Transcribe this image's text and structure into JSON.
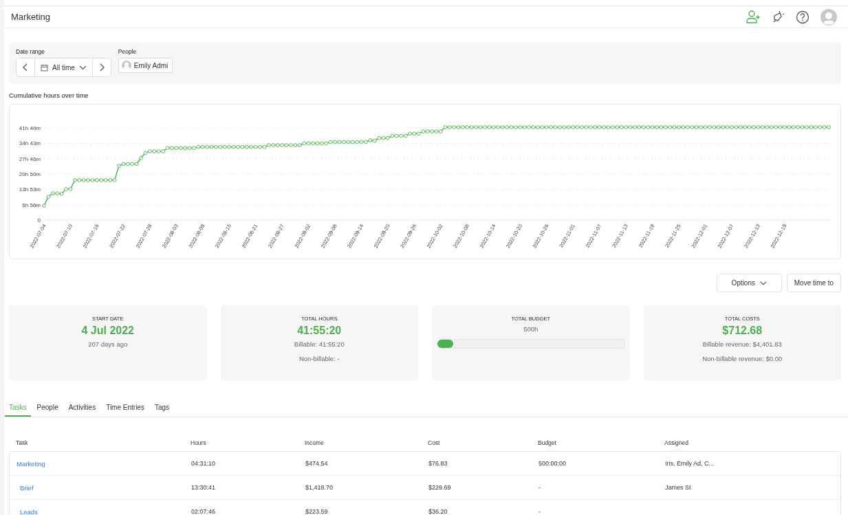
{
  "header": {
    "title": "Marketing"
  },
  "filters": {
    "date_range": {
      "label": "Date range",
      "value": "All time"
    },
    "people": {
      "label": "People",
      "value": "Emily Admi"
    }
  },
  "chart": {
    "title": "Cumulative hours over time",
    "y_labels": [
      "41h 40m",
      "34h 43m",
      "27h 46m",
      "20h 50m",
      "13h 53m",
      "6h 56m",
      "0"
    ],
    "x_labels": [
      "2022-07-04",
      "2022-07-10",
      "2022-07-16",
      "2022-07-22",
      "2022-07-28",
      "2022-08-03",
      "2022-08-09",
      "2022-08-15",
      "2022-08-21",
      "2022-08-27",
      "2022-09-02",
      "2022-09-08",
      "2022-09-14",
      "2022-09-20",
      "2022-09-26",
      "2022-10-02",
      "2022-10-08",
      "2022-10-14",
      "2022-10-20",
      "2022-10-26",
      "2022-11-01",
      "2022-11-07",
      "2022-11-13",
      "2022-11-19",
      "2022-11-25",
      "2022-12-01",
      "2022-12-07",
      "2022-12-13",
      "2022-12-19"
    ]
  },
  "actions": [
    {
      "label": "Options",
      "kind": "dropdown"
    },
    {
      "label": "Move time to",
      "kind": "button"
    }
  ],
  "stats": [
    {
      "kind": "value",
      "label": "START DATE",
      "value": "4 Jul 2022",
      "lines": [
        "207 days ago"
      ]
    },
    {
      "kind": "value",
      "label": "TOTAL HOURS",
      "value": "41:55:20",
      "lines": [
        "Billable: 41:55:20",
        "Non-billable: -"
      ]
    },
    {
      "kind": "progress",
      "label": "TOTAL BUDGET",
      "lines": [
        "500h"
      ],
      "level": 0.084
    },
    {
      "kind": "value",
      "label": "TOTAL COSTS",
      "value": "$712.68",
      "lines": [
        "Billable revenue: $4,401.83",
        "Non-billable revenue: $0.00"
      ]
    }
  ],
  "tabs": [
    {
      "label": "Tasks",
      "selected": true
    },
    {
      "label": "People",
      "selected": false
    },
    {
      "label": "Activities",
      "selected": false
    },
    {
      "label": "Time Entries",
      "selected": false
    },
    {
      "label": "Tags",
      "selected": false
    }
  ],
  "table": {
    "columns": [
      "Task",
      "Hours",
      "Income",
      "Cost",
      "Budget",
      "Assigned"
    ],
    "rows": [
      {
        "task": "Marketing",
        "hours": "04:31:10",
        "income": "$474.54",
        "cost": "$76.83",
        "budget": "500:00:00",
        "assigned": "Iris, Emily Ad, C...",
        "children": [
          {
            "task": "Brief",
            "hours": "13:30:41",
            "income": "$1,418.70",
            "cost": "$229.69",
            "budget": "-",
            "assigned": "James St"
          },
          {
            "task": "Leads",
            "hours": "02:07:46",
            "income": "$223.59",
            "cost": "$36.20",
            "budget": "-"
          }
        ]
      }
    ]
  }
}
